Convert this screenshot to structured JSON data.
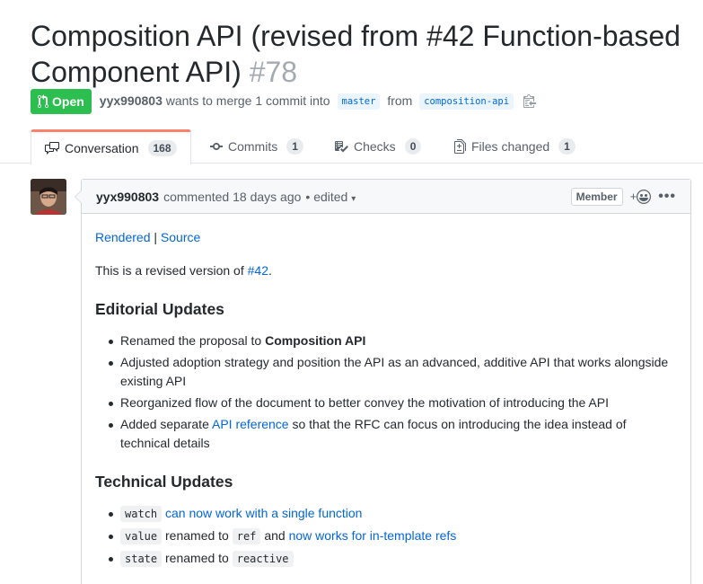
{
  "pr": {
    "title": "Composition API (revised from #42 Function-based Component API)",
    "number": "#78",
    "state": "Open",
    "author": "yyx990803",
    "merge_text": "wants to merge 1 commit into",
    "base_branch": "master",
    "from_text": "from",
    "head_branch": "composition-api"
  },
  "tabs": [
    {
      "label": "Conversation",
      "count": "168",
      "icon": "comment-discussion-icon"
    },
    {
      "label": "Commits",
      "count": "1",
      "icon": "git-commit-icon"
    },
    {
      "label": "Checks",
      "count": "0",
      "icon": "checklist-icon"
    },
    {
      "label": "Files changed",
      "count": "1",
      "icon": "file-diff-icon"
    }
  ],
  "comment": {
    "author": "yyx990803",
    "commented_text": "commented 18 days ago",
    "edited_text": "• edited",
    "badge": "Member",
    "reaction_plus": "+",
    "more": "•••",
    "links": {
      "rendered": "Rendered",
      "separator": "|",
      "source": "Source"
    },
    "intro_prefix": "This is a revised version of",
    "intro_link": "#42",
    "intro_suffix": ".",
    "editorial_heading": "Editorial Updates",
    "editorial": {
      "item1_prefix": "Renamed the proposal to",
      "item1_bold": "Composition API",
      "item2": "Adjusted adoption strategy and position the API as an advanced, additive API that works alongside existing API",
      "item3": "Reorganized flow of the document to better convey the motivation of introducing the API",
      "item4_prefix": "Added separate",
      "item4_link": "API reference",
      "item4_suffix": "so that the RFC can focus on introducing the idea instead of technical details"
    },
    "technical_heading": "Technical Updates",
    "technical": {
      "item1_code": "watch",
      "item1_link": "can now work with a single function",
      "item2_code": "value",
      "item2_mid": "renamed to",
      "item2_code2": "ref",
      "item2_and": "and",
      "item2_link": "now works for in-template refs",
      "item3_code": "state",
      "item3_mid": "renamed to",
      "item3_code2": "reactive"
    }
  },
  "colors": {
    "open_green": "#2cbe4e",
    "link_blue": "#0366d6",
    "tab_accent": "#f9826c"
  }
}
